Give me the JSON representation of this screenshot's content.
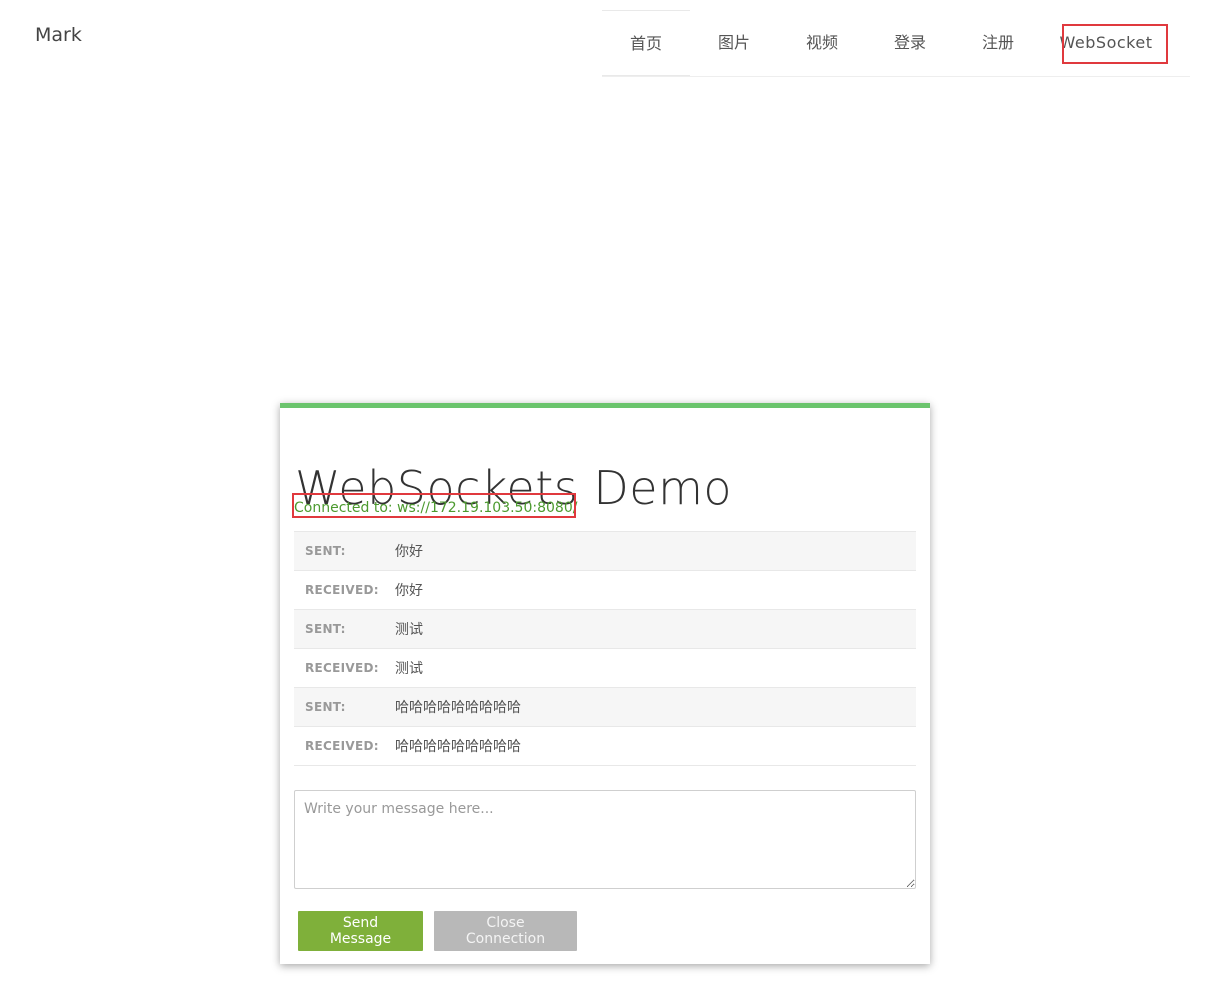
{
  "header": {
    "brand": "Mark",
    "nav": [
      {
        "label": "首页"
      },
      {
        "label": "图片"
      },
      {
        "label": "视频"
      },
      {
        "label": "登录"
      },
      {
        "label": "注册"
      },
      {
        "label": "WebSocket"
      }
    ]
  },
  "demo": {
    "title": "WebSockets Demo",
    "status": "Connected to: ws://172.19.103.50:8080/",
    "messages": [
      {
        "kind": "SENT:",
        "text": "你好"
      },
      {
        "kind": "RECEIVED:",
        "text": "你好"
      },
      {
        "kind": "SENT:",
        "text": "测试"
      },
      {
        "kind": "RECEIVED:",
        "text": "测试"
      },
      {
        "kind": "SENT:",
        "text": "哈哈哈哈哈哈哈哈哈"
      },
      {
        "kind": "RECEIVED:",
        "text": "哈哈哈哈哈哈哈哈哈"
      }
    ],
    "input_placeholder": "Write your message here...",
    "input_value": "",
    "send_label": "Send Message",
    "close_label": "Close Connection"
  },
  "colors": {
    "accent_green": "#6bc46d",
    "send_button": "#7fb03a",
    "close_button": "#b8b8b8",
    "status_text": "#4c9a2f",
    "highlight_box": "#e0393e"
  }
}
